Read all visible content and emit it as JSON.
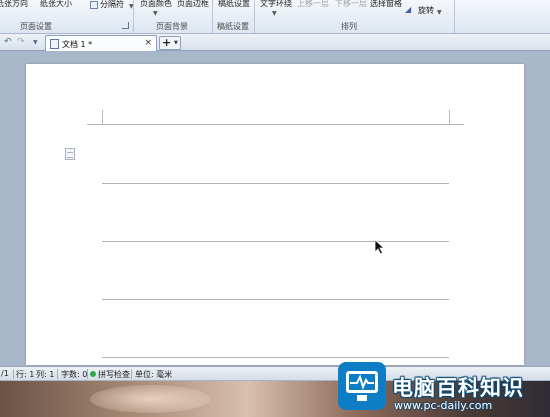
{
  "ribbon": {
    "buttons": {
      "orientation": "纸张方向",
      "size": "纸张大小",
      "separator": "分隔符",
      "page_color": "页面颜色",
      "page_border": "页面边框",
      "draft_setting": "稿纸设置",
      "text_wrap": "文字环绕",
      "bring_forward": "上移一层",
      "send_backward": "下移一层",
      "selection_pane": "选择窗格",
      "rotate": "旋转"
    },
    "groups": {
      "page_setup": "页面设置",
      "page_background": "页面背景",
      "draft_paper": "稿纸设置",
      "arrange": "排列"
    }
  },
  "tabbar": {
    "document_tab": "文档 1 *",
    "close_glyph": "×",
    "new_tab_glyph": "+",
    "undo_glyph": "↶",
    "redo_glyph": "↷"
  },
  "statusbar": {
    "page": "/1",
    "row": "行: 1",
    "col": "列: 1",
    "word_count": "字数: 0",
    "spell_check": "拼写检查",
    "unit": "单位: 毫米"
  },
  "watermark": {
    "title": "电脑百科知识",
    "url": "www.pc-daily.com"
  },
  "colors": {
    "watermark_blue": "#0d7dc5",
    "workspace_bg": "#a9b7ca",
    "spell_ok": "#32a84a"
  },
  "icons": [
    "undo-icon",
    "redo-icon",
    "document-icon",
    "close-icon",
    "plus-icon",
    "rotate-icon",
    "paragraph-icon",
    "mouse-pointer-icon",
    "monitor-logo-icon"
  ]
}
